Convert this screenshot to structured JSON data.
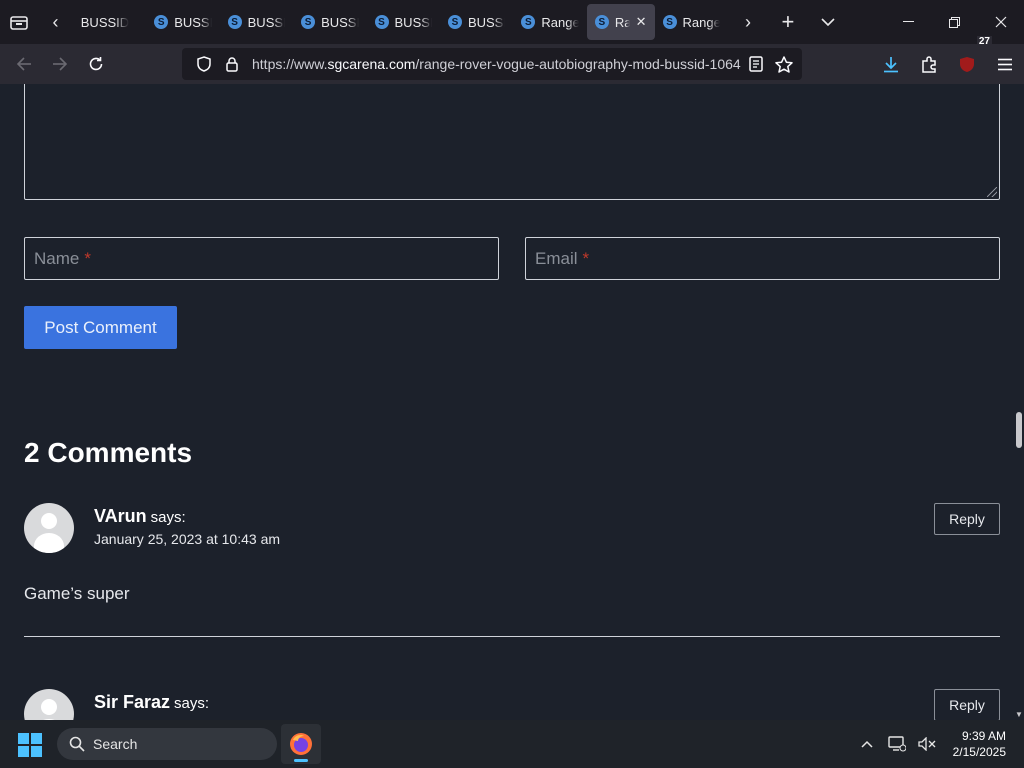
{
  "browser": {
    "tabs": [
      {
        "title": "BUSSID"
      },
      {
        "title": "BUSSID"
      },
      {
        "title": "BUSSID"
      },
      {
        "title": "BUSSID"
      },
      {
        "title": "BUSSID"
      },
      {
        "title": "BUSSID"
      },
      {
        "title": "Range Rover"
      },
      {
        "title": "Range Rover"
      },
      {
        "title": "Range Rover"
      }
    ],
    "active_tab_index": 7,
    "url_prefix": "https://www.",
    "url_domain": "sgcarena.com",
    "url_path": "/range-rover-vogue-autobiography-mod-bussid-1064",
    "extensions_badge": "27",
    "icons": {
      "tab_list": "tabs-list-icon",
      "scroll_left": "chevron-left-icon",
      "scroll_right": "chevron-right-icon",
      "new_tab": "plus-icon",
      "all_tabs": "chevron-down-icon",
      "minimize": "minimize-icon",
      "restore": "restore-icon",
      "close": "close-icon",
      "back": "back-arrow-icon",
      "forward": "forward-arrow-icon",
      "reload": "reload-icon",
      "shield": "shield-icon",
      "lock": "lock-icon",
      "reader": "reader-view-icon",
      "bookmark": "star-icon",
      "downloads": "download-icon",
      "extensions": "puzzle-icon",
      "menu": "hamburger-menu-icon"
    },
    "accent_color": "#3a73df"
  },
  "form": {
    "name_placeholder": "Name",
    "email_placeholder": "Email",
    "required_mark": "*",
    "submit_label": "Post Comment"
  },
  "comments": {
    "heading": "2 Comments",
    "items": [
      {
        "author": "VArun",
        "says": "says:",
        "date": "January 25, 2023 at 10:43 am",
        "body": "Game’s super",
        "reply_label": "Reply"
      },
      {
        "author": "Sir Faraz",
        "says": "says:",
        "date": "",
        "body": "",
        "reply_label": "Reply"
      }
    ]
  },
  "taskbar": {
    "search_label": "Search",
    "time": "9:39 AM",
    "date": "2/15/2025"
  }
}
